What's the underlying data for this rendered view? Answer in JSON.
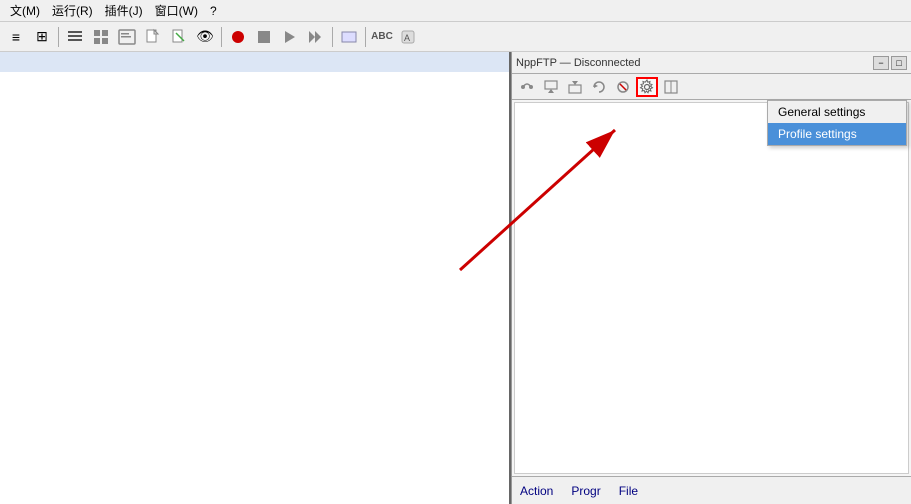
{
  "menu": {
    "items": [
      "文(M)",
      "运行(R)",
      "插件(J)",
      "窗口(W)",
      "?"
    ]
  },
  "toolbar": {
    "buttons": [
      "≡",
      "⊞",
      "T",
      "▥",
      "⊡",
      "📄",
      "⊡",
      "🔍",
      "⊕",
      "⊠",
      "▶",
      "▶▶",
      "⊞",
      "ABC",
      "⊡"
    ]
  },
  "ftp": {
    "title": "NppFTP — Disconnected",
    "general_settings": "General settings",
    "profile_settings": "Profile settings",
    "bottom_tabs": [
      "Action",
      "Progr",
      "File"
    ]
  },
  "dropdown": {
    "items": [
      {
        "label": "General settings",
        "selected": false
      },
      {
        "label": "Profile settings",
        "selected": true
      }
    ]
  }
}
